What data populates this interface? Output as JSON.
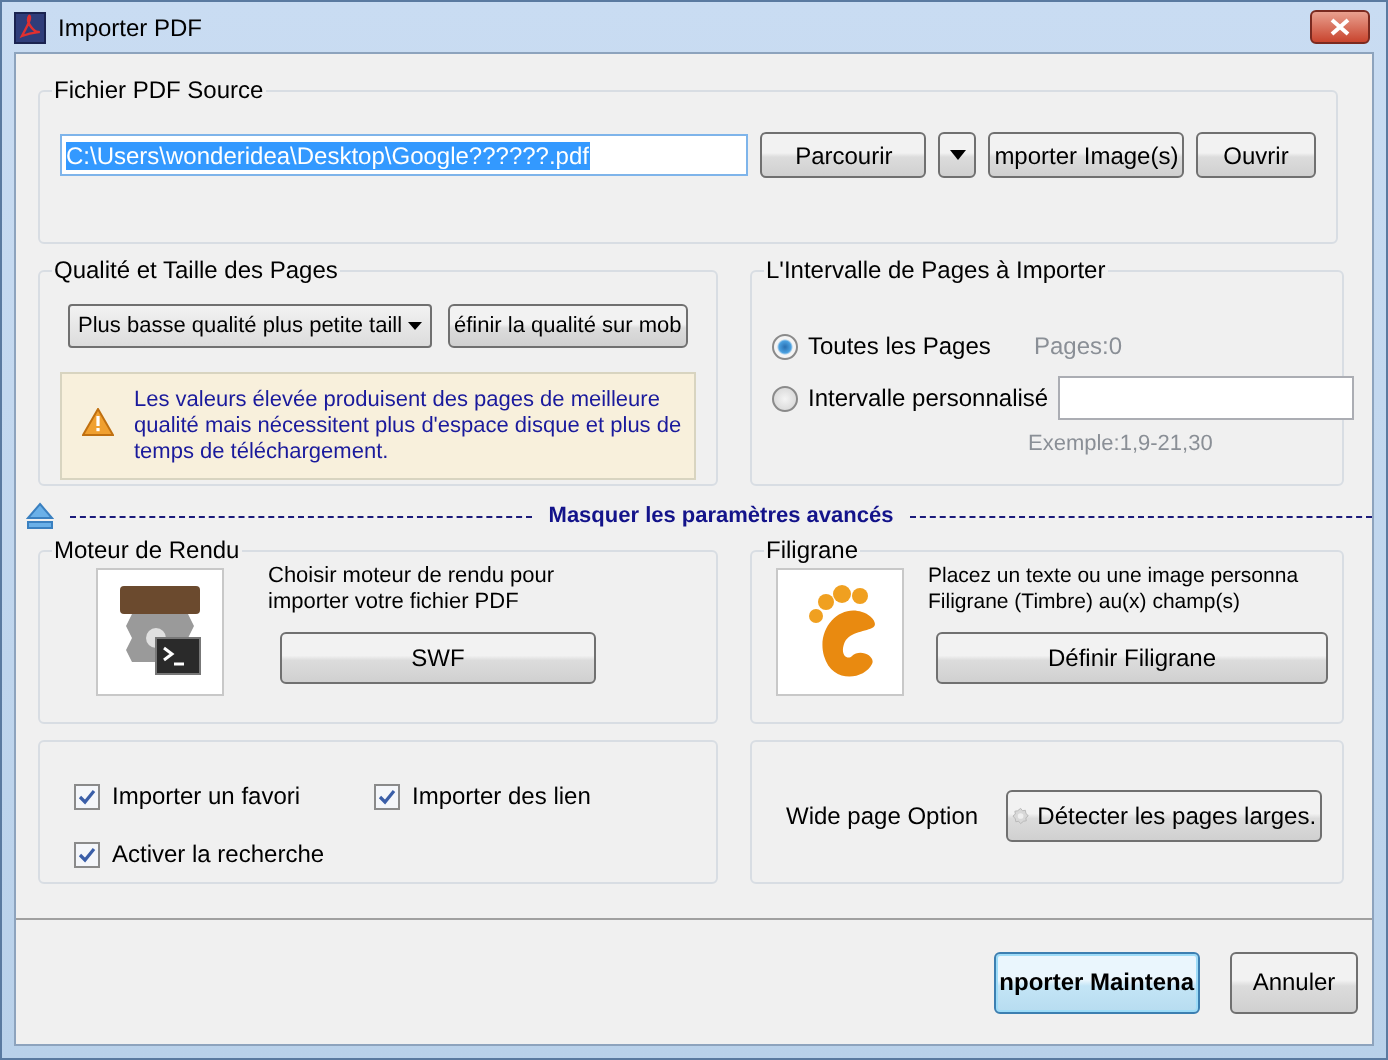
{
  "window": {
    "title": "Importer PDF"
  },
  "source": {
    "title": "Fichier PDF Source",
    "path": "C:\\Users\\wonderidea\\Desktop\\Google??????.pdf",
    "browse": "Parcourir",
    "import_images": "mporter Image(s)",
    "open": "Ouvrir"
  },
  "quality": {
    "title": "Qualité et Taille des Pages",
    "dropdown": "Plus basse qualité plus petite taill",
    "button": "éfinir la qualité sur mob",
    "warning": "Les valeurs élevée produisent des pages de meilleure qualité mais nécessitent plus d'espace disque et plus de temps de téléchargement."
  },
  "range": {
    "title": "L'Intervalle de Pages à Importer",
    "options": [
      {
        "label": "Toutes les Pages",
        "selected": true
      },
      {
        "label": "Intervalle personnalisé",
        "selected": false
      }
    ],
    "pages": "Pages:0",
    "example": "Exemple:1,9-21,30"
  },
  "advanced": {
    "label": "Masquer les paramètres avancés",
    "expanded": true
  },
  "renderer": {
    "title": "Moteur de Rendu",
    "text": "Choisir moteur de rendu pour importer votre fichier PDF",
    "button": "SWF"
  },
  "watermark": {
    "title": "Filigrane",
    "text": "Placez un texte ou une image personna Filigrane (Timbre) au(x) champ(s)",
    "button": "Définir Filigrane"
  },
  "options": [
    {
      "label": "Importer un favori",
      "checked": true
    },
    {
      "label": "Importer des lien",
      "checked": true
    },
    {
      "label": "Activer la recherche",
      "checked": true
    }
  ],
  "wide": {
    "label": "Wide page Option",
    "button": "Détecter les pages larges."
  },
  "footer": [
    {
      "label": "nporter Maintena",
      "primary": true
    },
    {
      "label": "Annuler",
      "primary": false
    }
  ]
}
